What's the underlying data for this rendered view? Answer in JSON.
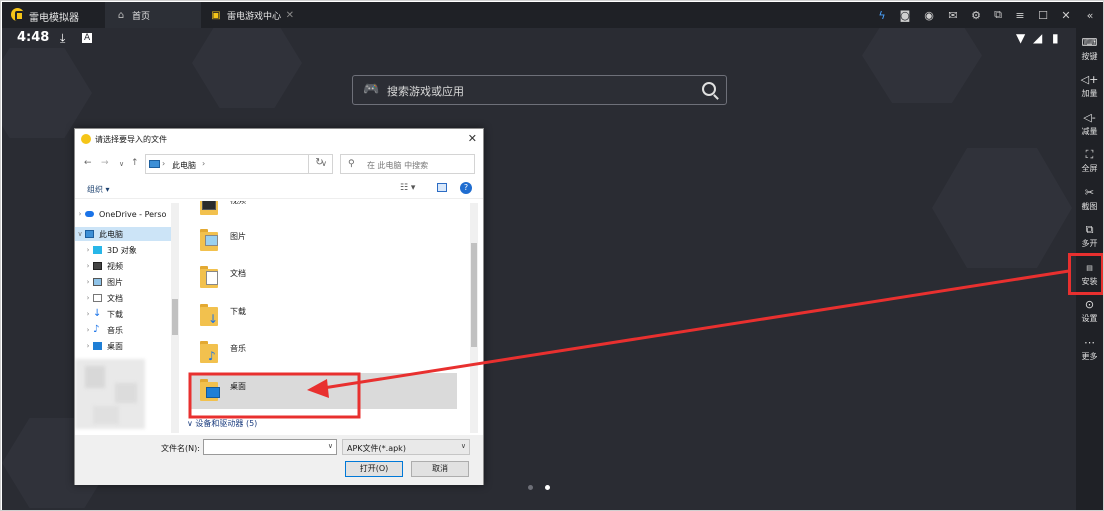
{
  "app": {
    "name": "雷电模拟器",
    "tabs": [
      {
        "label": "首页",
        "icon": "home-icon"
      },
      {
        "label": "雷电游戏中心",
        "icon": "game-center-icon"
      }
    ],
    "title_controls": [
      "lightning-icon",
      "gamepad-icon",
      "user-icon",
      "mail-icon",
      "settings-icon",
      "menu-icon",
      "minimize-icon",
      "maximize-icon",
      "close-icon",
      "collapse-icon"
    ],
    "accent_color": "#f5c518",
    "highlight_color": "#e8302f"
  },
  "status_bar": {
    "time": "4:48",
    "icons": [
      "download-icon",
      "notification-a-icon",
      "wifi-icon",
      "signal-icon",
      "battery-icon"
    ]
  },
  "home": {
    "search_placeholder": "搜索游戏或应用",
    "page_dots": 2,
    "active_dot": 1
  },
  "sidebar": {
    "items": [
      {
        "label": "按键",
        "icon": "keyboard-icon"
      },
      {
        "label": "加量",
        "icon": "volume-up-icon"
      },
      {
        "label": "减量",
        "icon": "volume-down-icon"
      },
      {
        "label": "全屏",
        "icon": "fullscreen-icon"
      },
      {
        "label": "截图",
        "icon": "scissors-icon"
      },
      {
        "label": "多开",
        "icon": "multi-open-icon"
      },
      {
        "label": "安装",
        "icon": "apk-install-icon",
        "highlighted": true
      },
      {
        "label": "设置",
        "icon": "gear-icon"
      },
      {
        "label": "更多",
        "icon": "more-icon"
      }
    ]
  },
  "dialog": {
    "title": "请选择要导入的文件",
    "address": "此电脑",
    "search_placeholder": "在 此电脑 中搜索",
    "organize": "组织 ▾",
    "nav_pane": [
      {
        "label": "OneDrive - Perso",
        "icon": "onedrive-icon",
        "level": 0,
        "expandable": true
      },
      {
        "label": "此电脑",
        "icon": "pc-icon",
        "level": 0,
        "expandable": true,
        "expanded": true,
        "selected": true
      },
      {
        "label": "3D 对象",
        "icon": "3d-objects-icon",
        "level": 1,
        "expandable": true
      },
      {
        "label": "视频",
        "icon": "video-folder-icon",
        "level": 1,
        "expandable": true
      },
      {
        "label": "图片",
        "icon": "pictures-folder-icon",
        "level": 1,
        "expandable": true
      },
      {
        "label": "文档",
        "icon": "documents-folder-icon",
        "level": 1,
        "expandable": true
      },
      {
        "label": "下载",
        "icon": "download-arrow-icon",
        "level": 1,
        "expandable": true
      },
      {
        "label": "音乐",
        "icon": "music-note-icon",
        "level": 1,
        "expandable": true
      },
      {
        "label": "桌面",
        "icon": "desktop-folder-icon",
        "level": 1,
        "expandable": true
      }
    ],
    "folders": [
      {
        "label": "视频",
        "icon": "video-folder-icon"
      },
      {
        "label": "图片",
        "icon": "pictures-folder-icon"
      },
      {
        "label": "文档",
        "icon": "documents-folder-icon"
      },
      {
        "label": "下载",
        "icon": "downloads-folder-icon"
      },
      {
        "label": "音乐",
        "icon": "music-folder-icon"
      },
      {
        "label": "桌面",
        "icon": "desktop-folder-icon",
        "selected": true
      }
    ],
    "group_header": "设备和驱动器 (5)",
    "filename_label": "文件名(N):",
    "filename_value": "",
    "filetype": "APK文件(*.apk)",
    "open_label": "打开(O)",
    "cancel_label": "取消"
  }
}
